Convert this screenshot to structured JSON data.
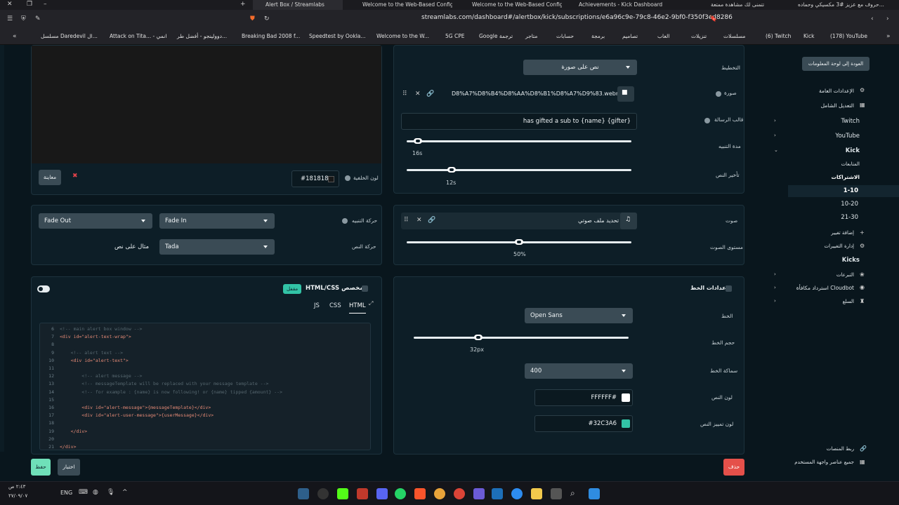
{
  "browser": {
    "tabs": [
      {
        "label": "Alert Box / Streamlabs"
      },
      {
        "label": "Welcome to the Web-Based Config..."
      },
      {
        "label": "Welcome to the Web-Based Config..."
      },
      {
        "label": "Achievements - Kick Dashboard"
      },
      {
        "label": "تتمنى لك مشاهدة ممتعة"
      },
      {
        "label": "حروف مع عزيز #3 مكسيكي وحماده..."
      }
    ],
    "url": "streamlabs.com/dashboard#/alertbox/kick/subscriptions/e6a96c9e-79c8-46e2-9bf0-f350f3ed8286",
    "bookmarks": [
      "مسلسل Daredevil ال...",
      "Attack on Tita... - انمي",
      "دوولينجو - أفضل طر...",
      "Breaking Bad 2008 f...",
      "Speedtest by Ookla...",
      "Welcome to the W...",
      "5G CPE",
      "Google ترجمة",
      "متاجر",
      "حسابات",
      "برمجة",
      "تصاميم",
      "العاب",
      "تنزيلات",
      "مسلسلات",
      "(6) Twitch",
      "Kick",
      "(178) YouTube"
    ]
  },
  "sidebar": {
    "back_button": "العودة إلى لوحة المعلومات",
    "general_settings": "الإعدادات العامة",
    "global_edit": "التعديل الشامل",
    "platforms": [
      "Twitch",
      "YouTube",
      "Kick"
    ],
    "kick_items": [
      "المتابعات",
      "الاشتراكات"
    ],
    "sub_ranges": [
      "1-10",
      "10-20",
      "21-30"
    ],
    "add_variation": "إضافة تغيير",
    "manage_variations": "إدارة التغييرات",
    "kicks": "Kicks",
    "donations": "التبرعات",
    "cloudbot": "استرداد مكافأة Cloudbot",
    "merch": "السلع",
    "link_platforms": "ربط المنصات",
    "all_widgets": "جميع عناصر واجهة المستخدم"
  },
  "preview": {
    "preview_button": "معاينة",
    "bg_color_label": "لون الخلفية",
    "bg_color_value": "#181818"
  },
  "layout_settings": {
    "layout_label": "التخطيط",
    "layout_value": "نص على صورة",
    "image_label": "صورة",
    "image_file": "D8%A7%D8%B4%D8%AA%D8%B1%D8%A7%D9%83.webm",
    "message_template_label": "قالب الرسالة",
    "message_template_value": "has gifted a sub to {name} {gifter}",
    "alert_duration_label": "مدة التنبيه",
    "alert_duration_value": "16s",
    "alert_duration_fraction": 0.05,
    "text_delay_label": "تأخير النص",
    "text_delay_value": "12s",
    "text_delay_fraction": 0.2
  },
  "animation": {
    "alert_animation_label": "حركة التنبيه",
    "out_value": "Fade Out",
    "in_value": "Fade In",
    "text_animation_label": "حركة النص",
    "text_anim_value": "Tada",
    "example_text": "مثال على نص"
  },
  "sound": {
    "sound_label": "صوت",
    "select_sound_file": "تحديد ملف صوتي",
    "volume_label": "مستوى الصوت",
    "volume_value": "50%",
    "volume_fraction": 0.5
  },
  "custom_html": {
    "title": "HTML/CSS مخصص",
    "badge": "مقفل",
    "tabs": [
      "HTML",
      "CSS",
      "JS"
    ],
    "code_lines": [
      {
        "n": "6",
        "text": "<!-- main alert box window -->",
        "c": "#56676f"
      },
      {
        "n": "7",
        "text": "<div id=\"alert-text-wrap\">",
        "c": "#e58a76"
      },
      {
        "n": "8",
        "text": "",
        "c": "#56676f"
      },
      {
        "n": "9",
        "text": "    <!-- alert text -->",
        "c": "#56676f"
      },
      {
        "n": "10",
        "text": "    <div id=\"alert-text\">",
        "c": "#e58a76"
      },
      {
        "n": "11",
        "text": "",
        "c": "#56676f"
      },
      {
        "n": "12",
        "text": "        <!-- alert message -->",
        "c": "#56676f"
      },
      {
        "n": "13",
        "text": "        <!-- messageTemplate will be replaced with your message template -->",
        "c": "#56676f"
      },
      {
        "n": "14",
        "text": "        <!-- for example : {name} is now following! or {name} tipped {amount} -->",
        "c": "#56676f"
      },
      {
        "n": "15",
        "text": "",
        "c": "#56676f"
      },
      {
        "n": "16",
        "text": "        <div id=\"alert-message\">{messageTemplate}</div>",
        "c": "#e58a76"
      },
      {
        "n": "17",
        "text": "        <div id=\"alert-user-message\">{userMessage}</div>",
        "c": "#e58a76"
      },
      {
        "n": "18",
        "text": "",
        "c": "#56676f"
      },
      {
        "n": "19",
        "text": "    </div>",
        "c": "#e58a76"
      },
      {
        "n": "20",
        "text": "",
        "c": "#56676f"
      },
      {
        "n": "21",
        "text": "</div>",
        "c": "#e58a76"
      }
    ]
  },
  "font_settings": {
    "title": "إعدادات الخط",
    "font_label": "الخط",
    "font_value": "Open Sans",
    "font_size_label": "حجم الخط",
    "font_size_value": "32px",
    "font_size_fraction": 0.3,
    "font_weight_label": "سماكة الخط",
    "font_weight_value": "400",
    "text_color_label": "لون النص",
    "text_color_value": "FFFFFF#",
    "text_color": "#FFFFFF",
    "highlight_color_label": "لون تمييز النص",
    "highlight_color_value": "#32C3A6",
    "highlight_color": "#32C3A6"
  },
  "footer": {
    "save": "حفظ",
    "test": "اختبار",
    "delete": "حذف"
  },
  "taskbar": {
    "lang": "ENG",
    "time": "٢:٤٣ ص",
    "date": "٢٧/٠٩/٠٧"
  }
}
